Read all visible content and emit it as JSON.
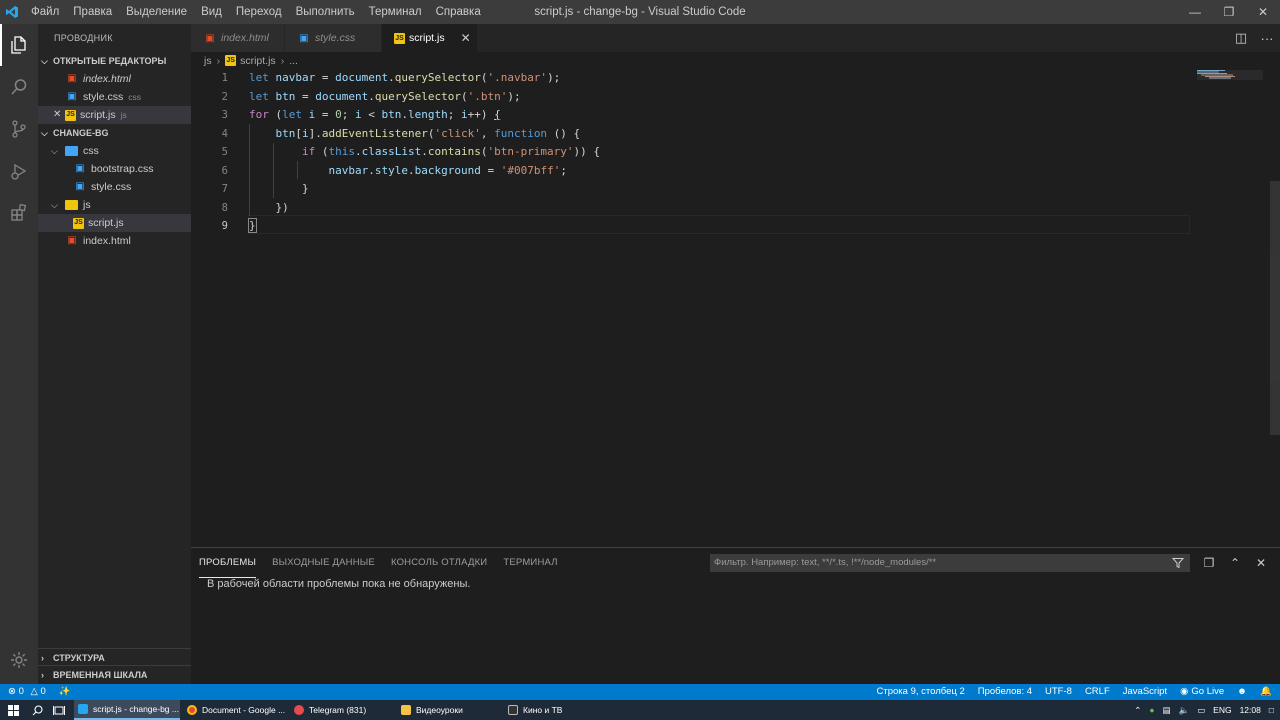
{
  "window": {
    "title": "script.js - change-bg - Visual Studio Code",
    "menu": [
      "Файл",
      "Правка",
      "Выделение",
      "Вид",
      "Переход",
      "Выполнить",
      "Терминал",
      "Справка"
    ]
  },
  "explorer": {
    "title": "ПРОВОДНИК",
    "open_editors_header": "ОТКРЫТЫЕ РЕДАКТОРЫ",
    "open_editors": [
      {
        "name": "index.html",
        "desc": ""
      },
      {
        "name": "style.css",
        "desc": "css"
      },
      {
        "name": "script.js",
        "desc": "js"
      }
    ],
    "project_header": "CHANGE-BG",
    "tree": {
      "css_folder": "css",
      "css_files": [
        "bootstrap.css",
        "style.css"
      ],
      "js_folder": "js",
      "js_files": [
        "script.js"
      ],
      "root_files": [
        "index.html"
      ]
    },
    "outline_header": "СТРУКТУРА",
    "timeline_header": "ВРЕМЕННАЯ ШКАЛА"
  },
  "tabs": [
    {
      "label": "index.html"
    },
    {
      "label": "style.css"
    },
    {
      "label": "script.js"
    }
  ],
  "breadcrumb": {
    "folder": "js",
    "file": "script.js",
    "more": "..."
  },
  "editor": {
    "line_numbers": [
      "1",
      "2",
      "3",
      "4",
      "5",
      "6",
      "7",
      "8",
      "9"
    ]
  },
  "panel": {
    "tabs": [
      "ПРОБЛЕМЫ",
      "ВЫХОДНЫЕ ДАННЫЕ",
      "КОНСОЛЬ ОТЛАДКИ",
      "ТЕРМИНАЛ"
    ],
    "filter_placeholder": "Фильтр. Например: text, **/*.ts, !**/node_modules/**",
    "message": "В рабочей области проблемы пока не обнаружены."
  },
  "statusbar": {
    "errors": "0",
    "warnings": "0",
    "position": "Строка 9, столбец 2",
    "spaces": "Пробелов: 4",
    "encoding": "UTF-8",
    "eol": "CRLF",
    "language": "JavaScript",
    "golive": "Go Live"
  },
  "taskbar": {
    "apps": [
      {
        "label": "script.js - change-bg ..."
      },
      {
        "label": "Document - Google ..."
      },
      {
        "label": "Telegram (831)"
      },
      {
        "label": "Видеоуроки"
      },
      {
        "label": "Кино и ТВ"
      }
    ],
    "lang": "ENG",
    "time": "12:08"
  },
  "colors": {
    "accent": "#007acc",
    "editor_bg": "#1e1e1e",
    "sidebar_bg": "#252526",
    "activity_bg": "#333333"
  }
}
